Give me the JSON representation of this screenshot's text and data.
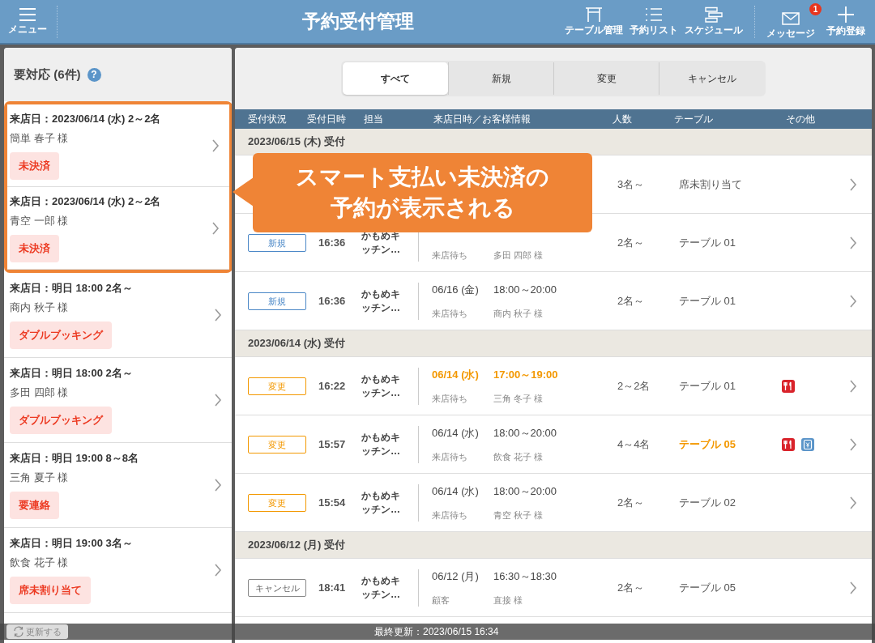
{
  "header": {
    "menu_label": "メニュー",
    "title": "予約受付管理",
    "tools": [
      {
        "kind": "table",
        "label": "テーブル管理"
      },
      {
        "kind": "list",
        "label": "予約リスト"
      },
      {
        "kind": "schedule",
        "label": "スケジュール"
      }
    ],
    "message": {
      "label": "メッセージ",
      "badge": "1"
    },
    "add_label": "予約登録"
  },
  "sidebar": {
    "title": "要対応 (6件)",
    "help": "?",
    "items": [
      {
        "visit": "来店日：2023/06/14 (水) 2～2名",
        "name": "簡単 春子 様",
        "tag": "未決済",
        "highlighted": true
      },
      {
        "visit": "来店日：2023/06/14 (水) 2～2名",
        "name": "青空 一郎 様",
        "tag": "未決済",
        "highlighted": true
      },
      {
        "visit": "来店日：明日 18:00 2名～",
        "name": "商内 秋子 様",
        "tag": "ダブルブッキング",
        "highlighted": false
      },
      {
        "visit": "来店日：明日 18:00 2名～",
        "name": "多田 四郎 様",
        "tag": "ダブルブッキング",
        "highlighted": false
      },
      {
        "visit": "来店日：明日 19:00 8～8名",
        "name": "三角 夏子 様",
        "tag": "要連絡",
        "highlighted": false
      },
      {
        "visit": "来店日：明日 19:00 3名～",
        "name": "飲食 花子 様",
        "tag": "席未割り当て",
        "highlighted": false
      }
    ]
  },
  "tabs": [
    {
      "label": "すべて",
      "selected": true
    },
    {
      "label": "新規",
      "selected": false
    },
    {
      "label": "変更",
      "selected": false
    },
    {
      "label": "キャンセル",
      "selected": false
    }
  ],
  "columns": [
    "受付状況",
    "受付日時",
    "担当",
    "来店日時／お客様情報",
    "人数",
    "テーブル",
    "その他"
  ],
  "groups": [
    {
      "label": "2023/06/15 (木) 受付",
      "rows": [
        {
          "people": "3名～",
          "table": "席未割り当て"
        },
        {
          "status": {
            "kind": "new",
            "label": "新規"
          },
          "time": "16:36",
          "staff": "かもめキッチン…",
          "visit_status": "来店待ち",
          "customer": "多田 四郎 様",
          "people": "2名～",
          "table": "テーブル 01"
        },
        {
          "status": {
            "kind": "new",
            "label": "新規"
          },
          "time": "16:36",
          "staff": "かもめキッチン…",
          "date": "06/16 (金)",
          "slot": "18:00～20:00",
          "visit_status": "来店待ち",
          "customer": "商内 秋子 様",
          "people": "2名～",
          "table": "テーブル 01"
        }
      ]
    },
    {
      "label": "2023/06/14 (水) 受付",
      "rows": [
        {
          "status": {
            "kind": "change",
            "label": "変更"
          },
          "time": "16:22",
          "staff": "かもめキッチン…",
          "date": "06/14 (水)",
          "slot": "17:00～19:00",
          "date_changed": true,
          "visit_status": "来店待ち",
          "customer": "三角 冬子 様",
          "people": "2～2名",
          "table": "テーブル 01",
          "icons": [
            {
              "kind": "restaurant"
            }
          ]
        },
        {
          "status": {
            "kind": "change",
            "label": "変更"
          },
          "time": "15:57",
          "staff": "かもめキッチン…",
          "date": "06/14 (水)",
          "slot": "18:00～20:00",
          "visit_status": "来店待ち",
          "customer": "飲食 花子 様",
          "people": "4～4名",
          "table": "テーブル 05",
          "table_changed": true,
          "icons": [
            {
              "kind": "restaurant"
            },
            {
              "kind": "payment"
            }
          ]
        },
        {
          "status": {
            "kind": "change",
            "label": "変更"
          },
          "time": "15:54",
          "staff": "かもめキッチン…",
          "date": "06/14 (水)",
          "slot": "18:00～20:00",
          "visit_status": "来店待ち",
          "customer": "青空 秋子 様",
          "people": "2名～",
          "table": "テーブル 02"
        }
      ]
    },
    {
      "label": "2023/06/12 (月) 受付",
      "rows": [
        {
          "status": {
            "kind": "cancel",
            "label": "キャンセル"
          },
          "time": "18:41",
          "staff": "かもめキッチン…",
          "date": "06/12 (月)",
          "slot": "16:30～18:30",
          "visit_status": "顧客",
          "customer": "直接 様",
          "people": "2名～",
          "table": "テーブル 05"
        }
      ]
    }
  ],
  "callout": "スマート支払い未決済の予約が表示される",
  "footer": {
    "refresh": "更新する",
    "last_updated": "最終更新：2023/06/15 16:34"
  }
}
